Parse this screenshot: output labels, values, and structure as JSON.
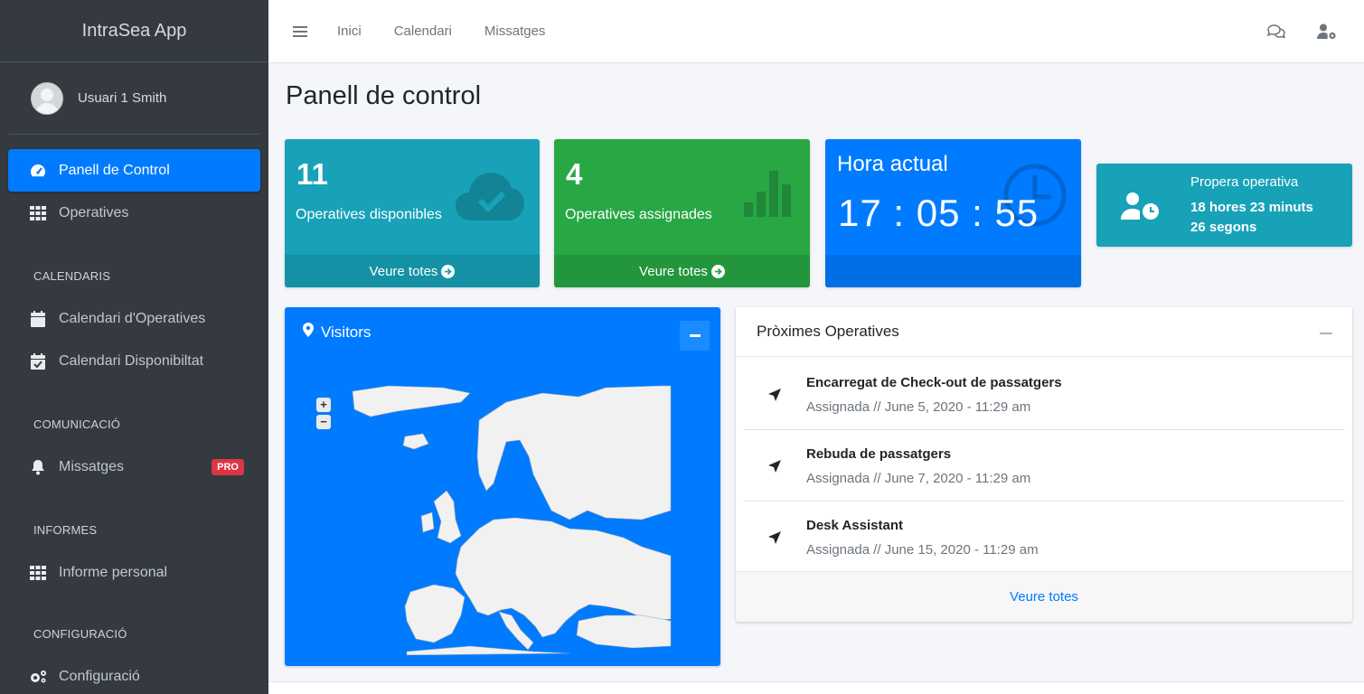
{
  "app": {
    "title": "IntraSea App"
  },
  "user": {
    "name": "Usuari 1 Smith"
  },
  "sidebar": {
    "items": [
      {
        "label": "Panell de Control",
        "icon": "tachometer-icon",
        "active": true
      },
      {
        "label": "Operatives",
        "icon": "grid-icon"
      }
    ],
    "sections": [
      {
        "header": "CALENDARIS",
        "items": [
          {
            "label": "Calendari d'Operatives",
            "icon": "calendar-icon"
          },
          {
            "label": "Calendari Disponibiltat",
            "icon": "calendar-check-icon"
          }
        ]
      },
      {
        "header": "COMUNICACIÓ",
        "items": [
          {
            "label": "Missatges",
            "icon": "bell-icon",
            "badge": "PRO"
          }
        ]
      },
      {
        "header": "INFORMES",
        "items": [
          {
            "label": "Informe personal",
            "icon": "grid-icon"
          }
        ]
      },
      {
        "header": "CONFIGURACIÓ",
        "items": [
          {
            "label": "Configuració",
            "icon": "gears-icon"
          }
        ]
      }
    ]
  },
  "topbar": {
    "links": [
      "Inici",
      "Calendari",
      "Missatges"
    ]
  },
  "page": {
    "title": "Panell de control"
  },
  "boxes": {
    "available": {
      "value": "11",
      "label": "Operatives disponibles",
      "footer": "Veure totes"
    },
    "assigned": {
      "value": "4",
      "label": "Operatives assignades",
      "footer": "Veure totes"
    },
    "clock": {
      "title": "Hora actual",
      "value": "17 : 05 : 55"
    }
  },
  "next_op": {
    "title": "Propera operativa",
    "line1": "18 hores 23 minuts",
    "line2": "26 segons"
  },
  "visitors": {
    "title": "Visitors",
    "zoom_in": "+",
    "zoom_out": "−"
  },
  "upcoming": {
    "title": "Pròximes Operatives",
    "items": [
      {
        "title": "Encarregat de Check-out de passatgers",
        "sub": "Assignada // June 5, 2020 - 11:29 am"
      },
      {
        "title": "Rebuda de passatgers",
        "sub": "Assignada // June 7, 2020 - 11:29 am"
      },
      {
        "title": "Desk Assistant",
        "sub": "Assignada // June 15, 2020 - 11:29 am"
      }
    ],
    "footer": "Veure totes"
  },
  "colors": {
    "sidebar": "#343a40",
    "primary": "#007bff",
    "info": "#17a2b8",
    "success": "#28a745",
    "danger": "#dc3545"
  }
}
